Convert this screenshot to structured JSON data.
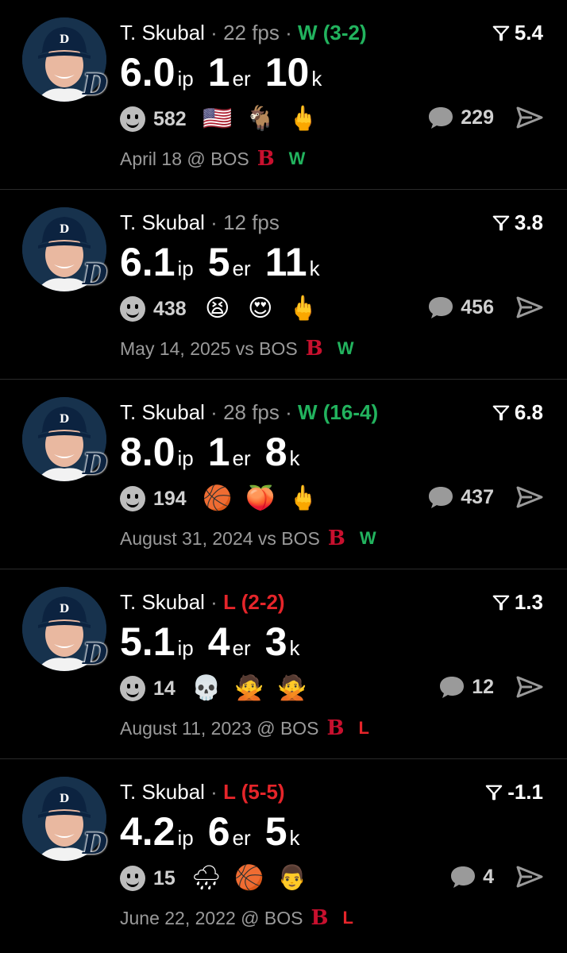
{
  "colors": {
    "background": "#000000",
    "win": "#22b35e",
    "loss": "#e5252a",
    "muted": "#9a9a9a",
    "redsox": "#c8102e"
  },
  "posts": [
    {
      "player": "T. Skubal",
      "fps": "22 fps",
      "record": "W (3-2)",
      "record_type": "win",
      "rating": "5.4",
      "stats": {
        "ip": "6.0",
        "ip_unit": "ip",
        "er": "1",
        "er_unit": "er",
        "k": "10",
        "k_unit": "k"
      },
      "reaction_count": "582",
      "emojis": [
        "flag-us-icon",
        "goat-icon",
        "middle-finger-icon"
      ],
      "emoji_glyphs": [
        "🇺🇸",
        "🐐",
        "🖕"
      ],
      "comment_count": "229",
      "game": "April 18 @ BOS",
      "team_logo": "B",
      "result": "W",
      "result_type": "win"
    },
    {
      "player": "T. Skubal",
      "fps": "12 fps",
      "record": "",
      "record_type": "none",
      "rating": "3.8",
      "stats": {
        "ip": "6.1",
        "ip_unit": "ip",
        "er": "5",
        "er_unit": "er",
        "k": "11",
        "k_unit": "k"
      },
      "reaction_count": "438",
      "emojis": [
        "tired-face-icon",
        "heart-eyes-icon",
        "middle-finger-icon"
      ],
      "emoji_glyphs": [
        "😫",
        "😍",
        "🖕"
      ],
      "comment_count": "456",
      "game": "May 14, 2025 vs BOS",
      "team_logo": "B",
      "result": "W",
      "result_type": "win"
    },
    {
      "player": "T. Skubal",
      "fps": "28 fps",
      "record": "W (16-4)",
      "record_type": "win",
      "rating": "6.8",
      "stats": {
        "ip": "8.0",
        "ip_unit": "ip",
        "er": "1",
        "er_unit": "er",
        "k": "8",
        "k_unit": "k"
      },
      "reaction_count": "194",
      "emojis": [
        "player-sticker-icon",
        "peach-icon",
        "middle-finger-icon"
      ],
      "emoji_glyphs": [
        "🏀",
        "🍑",
        "🖕"
      ],
      "comment_count": "437",
      "game": "August 31, 2024 vs BOS",
      "team_logo": "B",
      "result": "W",
      "result_type": "win"
    },
    {
      "player": "T. Skubal",
      "fps": "",
      "record": "L (2-2)",
      "record_type": "loss",
      "rating": "1.3",
      "stats": {
        "ip": "5.1",
        "ip_unit": "ip",
        "er": "4",
        "er_unit": "er",
        "k": "3",
        "k_unit": "k"
      },
      "reaction_count": "14",
      "emojis": [
        "skull-icon",
        "person-sticker-icon",
        "person-sticker-icon"
      ],
      "emoji_glyphs": [
        "💀",
        "🙅",
        "🙅"
      ],
      "comment_count": "12",
      "game": "August 11, 2023 @ BOS",
      "team_logo": "B",
      "result": "L",
      "result_type": "loss"
    },
    {
      "player": "T. Skubal",
      "fps": "",
      "record": "L (5-5)",
      "record_type": "loss",
      "rating": "-1.1",
      "stats": {
        "ip": "4.2",
        "ip_unit": "ip",
        "er": "6",
        "er_unit": "er",
        "k": "5",
        "k_unit": "k"
      },
      "reaction_count": "15",
      "emojis": [
        "rain-cloud-icon",
        "player-sticker-icon",
        "person-sticker-icon"
      ],
      "emoji_glyphs": [
        "🌧",
        "🏀",
        "👨"
      ],
      "comment_count": "4",
      "game": "June 22, 2022 @ BOS",
      "team_logo": "B",
      "result": "L",
      "result_type": "loss"
    }
  ]
}
